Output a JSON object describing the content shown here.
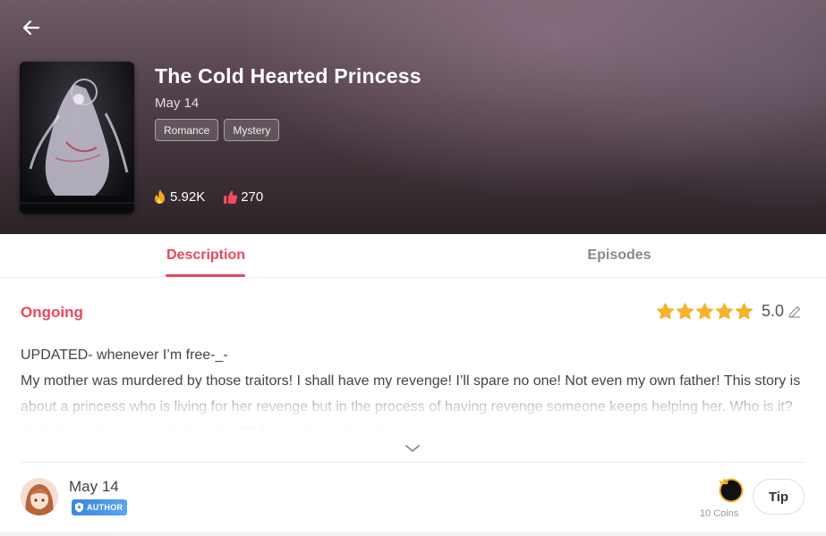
{
  "header": {
    "title": "The Cold Hearted Princess",
    "date": "May 14",
    "tags": [
      "Romance",
      "Mystery"
    ],
    "stats": {
      "views": "5.92K",
      "likes": "270"
    }
  },
  "tabs": [
    {
      "label": "Description",
      "active": true
    },
    {
      "label": "Episodes",
      "active": false
    }
  ],
  "description": {
    "status": "Ongoing",
    "rating": "5.0",
    "stars": 5,
    "lines": [
      "UPDATED- whenever I’m free-_-",
      "My mother was murdered by those traitors! I shall have my revenge! I’ll spare no one! Not even my own father!   This story is about a princess who is living for her revenge but in the process of having revenge someone keeps helping her.  Who is it? And why is that person helping her?What is their relation?..."
    ]
  },
  "author": {
    "date": "May 14",
    "badge": "AUTHOR"
  },
  "tip": {
    "coins_label": "10 Coins",
    "button_label": "Tip"
  },
  "icons": {
    "back": "back-arrow-icon",
    "views": "flame-icon",
    "likes": "thumbs-up-icon",
    "star": "star-icon",
    "edit": "pencil-icon",
    "expand": "chevron-down-icon",
    "coin": "coin-icon"
  },
  "colors": {
    "accent": "#e8485a",
    "star": "#f6b32b",
    "views_icon": "#f5a623",
    "likes_icon": "#f04e5b",
    "author_badge": "#3a86e0"
  }
}
